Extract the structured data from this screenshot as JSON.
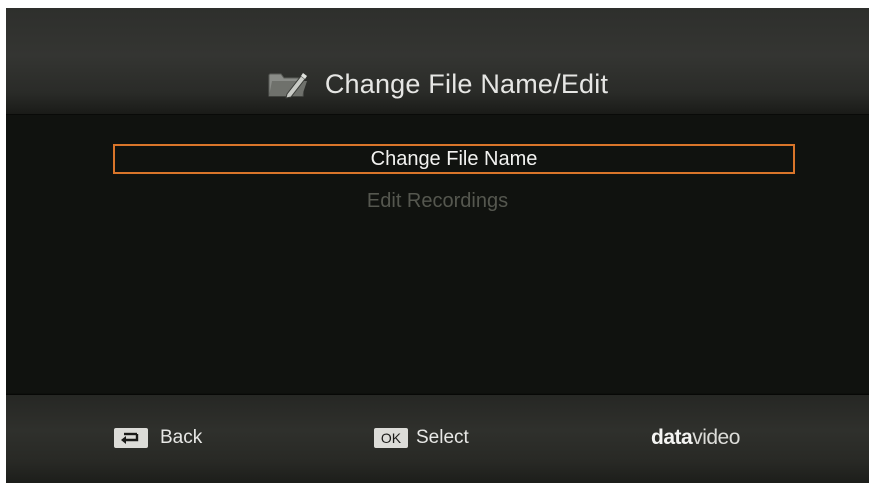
{
  "header": {
    "icon": "folder-edit-icon",
    "title": "Change File Name/Edit"
  },
  "menu": {
    "items": [
      {
        "label": "Change File Name",
        "state": "selected"
      },
      {
        "label": "Edit Recordings",
        "state": "disabled"
      }
    ],
    "highlight_color": "#d9752a"
  },
  "footer": {
    "back": {
      "icon": "return-arrow-icon",
      "label": "Back"
    },
    "select": {
      "key": "OK",
      "label": "Select"
    },
    "brand": {
      "bold": "data",
      "light": "video"
    }
  }
}
